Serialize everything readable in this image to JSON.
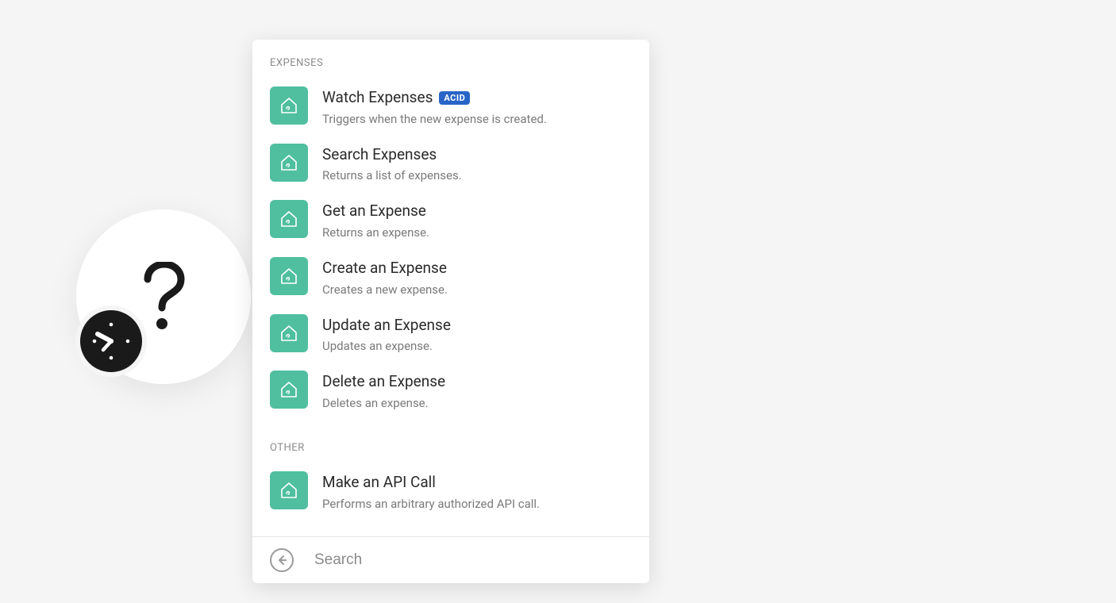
{
  "node": {
    "placeholder_icon": "question-mark",
    "badge_icon": "clock"
  },
  "panel": {
    "sections": [
      {
        "header": "EXPENSES",
        "items": [
          {
            "title": "Watch Expenses",
            "badge": "ACID",
            "desc": "Triggers when the new expense is created."
          },
          {
            "title": "Search Expenses",
            "desc": "Returns a list of expenses."
          },
          {
            "title": "Get an Expense",
            "desc": "Returns an expense."
          },
          {
            "title": "Create an Expense",
            "desc": "Creates a new expense."
          },
          {
            "title": "Update an Expense",
            "desc": "Updates an expense."
          },
          {
            "title": "Delete an Expense",
            "desc": "Deletes an expense."
          }
        ]
      },
      {
        "header": "OTHER",
        "items": [
          {
            "title": "Make an API Call",
            "desc": "Performs an arbitrary authorized API call."
          }
        ]
      }
    ]
  },
  "search": {
    "placeholder": "Search"
  },
  "colors": {
    "app_icon_bg": "#4fbf9f",
    "badge_bg": "#2864c7"
  }
}
